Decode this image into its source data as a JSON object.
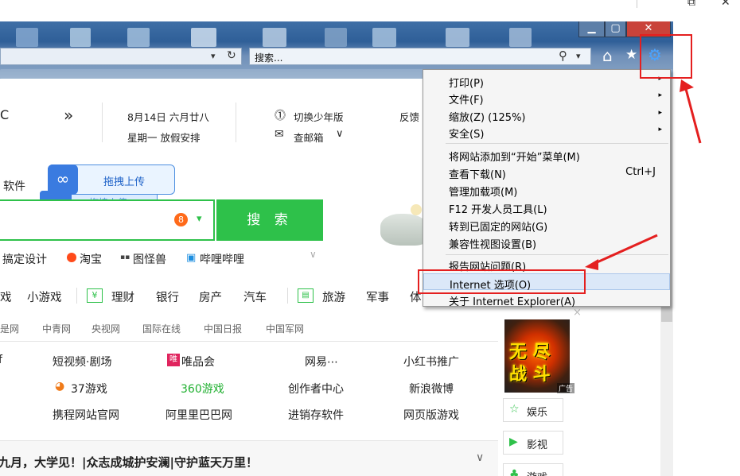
{
  "outer": {
    "restore_glyph": "⧉",
    "close_glyph": "✕"
  },
  "ie": {
    "win_min": "▁",
    "win_max": "▢",
    "win_close": "✕",
    "addr_dropdown": "▾",
    "refresh": "↻",
    "search_placeholder": "搜索...",
    "search_icon": "⚲",
    "search_dropdown": "▾",
    "home_glyph": "⌂",
    "fav_glyph": "★",
    "gear_glyph": "⚙"
  },
  "page": {
    "left_char": "C",
    "more_glyph": "»",
    "date": "8月14日  六月廿八",
    "weekday": "星期一  放假安排",
    "kids_icon": "⓵",
    "kids": "切换少年版",
    "mail_icon": "✉",
    "mail": "查邮箱",
    "mail_arrow": "∨",
    "feedback": "反馈",
    "software": "软件",
    "upload_main": "拖拽上传",
    "upload_ghost": "拖拽上传",
    "search_badge": "8",
    "search_arrow": "▾",
    "search_button": "搜 索",
    "quick_links": [
      "搞定设计",
      "淘宝",
      "图怪兽",
      "哔哩哔哩"
    ],
    "quick_expand": "∨",
    "nav": [
      "戏",
      "小游戏",
      "理财",
      "银行",
      "房产",
      "汽车",
      "旅游",
      "军事",
      "体"
    ],
    "nav_icon_finance": "¥",
    "nav_icon_travel": "▤",
    "news_sources": [
      "是网",
      "中青网",
      "央视网",
      "国际在线",
      "中国日报",
      "中国军网"
    ],
    "grid_row1": [
      "f",
      "短视频·剧场",
      "唯品会",
      "网易⋯",
      "小红书推广"
    ],
    "grid_row2": [
      "37游戏",
      "360游戏",
      "创作者中心",
      "新浪微博"
    ],
    "grid_row3": [
      "携程网站官网",
      "阿里里巴巴网",
      "进销存软件",
      "网页版游戏"
    ],
    "vip_badge": "唯",
    "game_icon": "◕",
    "headline": "九月，大学见！|众志成城护安澜|守护蓝天万里！",
    "headline_arrow": "∨",
    "game_ad_lines": [
      "无  尽",
      "战  斗"
    ],
    "game_ad_tag": "广告",
    "side_items": [
      "娱乐",
      "影视",
      "游戏"
    ],
    "side_icons": [
      "☆",
      "▶",
      "♣"
    ],
    "menu_close": "×",
    "colors": {
      "accent_green": "#2ec14a",
      "annotation_red": "#e41f1f",
      "grid_360": "#20b030"
    }
  },
  "menu": {
    "group1": [
      {
        "label": "打印(P)",
        "submenu": true
      },
      {
        "label": "文件(F)",
        "submenu": true
      },
      {
        "label": "缩放(Z) (125%)",
        "submenu": true
      },
      {
        "label": "安全(S)",
        "submenu": true
      }
    ],
    "group2": [
      {
        "label": "将网站添加到“开始”菜单(M)"
      },
      {
        "label": "查看下载(N)",
        "shortcut": "Ctrl+J"
      },
      {
        "label": "管理加载项(M)"
      },
      {
        "label": "F12 开发人员工具(L)"
      },
      {
        "label": "转到已固定的网站(G)"
      },
      {
        "label": "兼容性视图设置(B)"
      }
    ],
    "group3": [
      {
        "label": "报告网站问题(R)"
      },
      {
        "label": "Internet 选项(O)"
      },
      {
        "label": "关于 Internet Explorer(A)"
      }
    ],
    "arrow": "▸"
  }
}
